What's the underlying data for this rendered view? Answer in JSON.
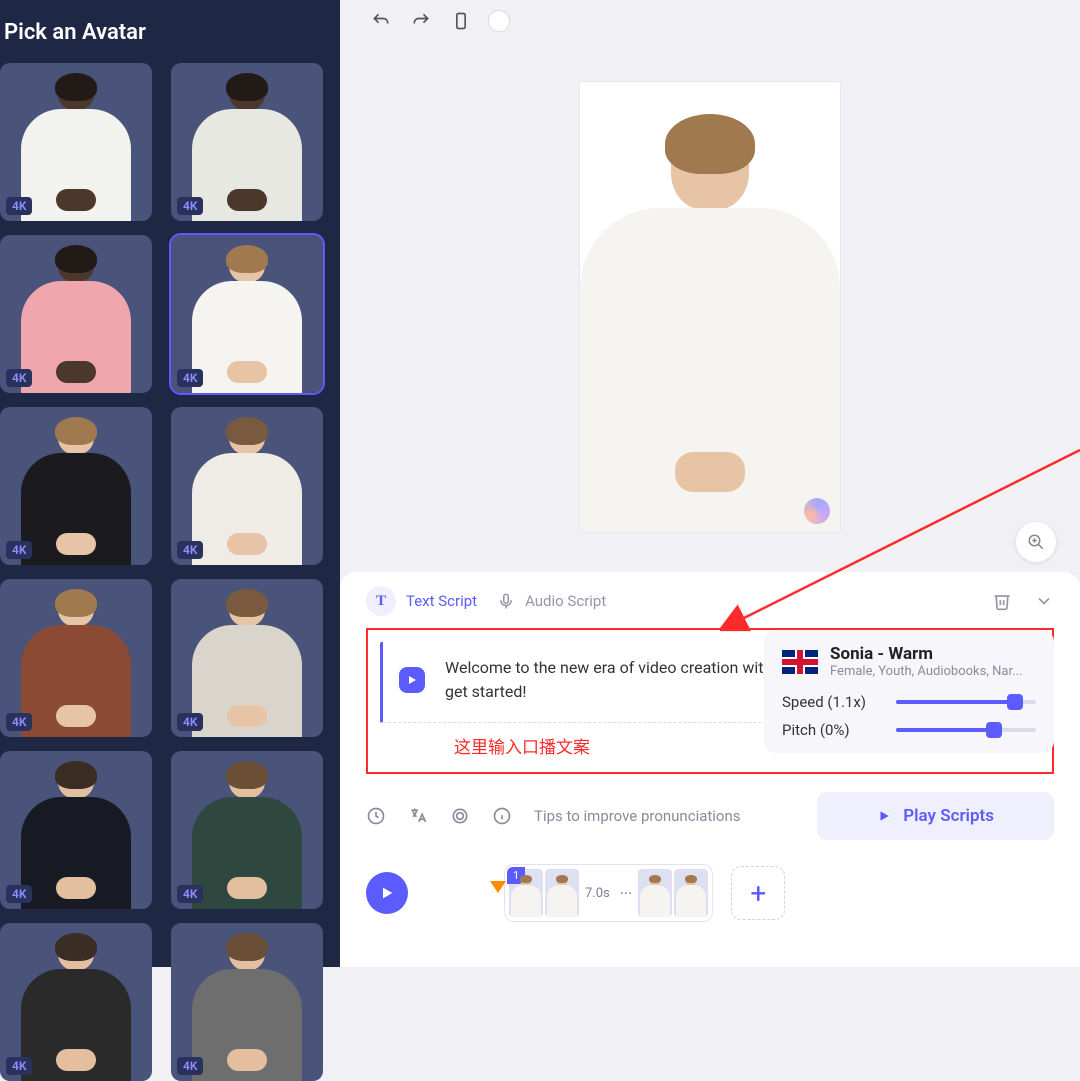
{
  "sidebar": {
    "title": "Pick an Avatar",
    "badge": "4K",
    "avatars": [
      {
        "hair": "#221a16",
        "skin": "#4b382a",
        "shirt": "#f2f2ee"
      },
      {
        "hair": "#221a16",
        "skin": "#4b382a",
        "shirt": "#e8e8e3"
      },
      {
        "hair": "#221a16",
        "skin": "#4b382a",
        "shirt": "#f0a6ad"
      },
      {
        "hair": "#a07a4e",
        "skin": "#e7c4a6",
        "shirt": "#f5f4f0",
        "selected": true
      },
      {
        "hair": "#a07a4e",
        "skin": "#e7c4a6",
        "shirt": "#1b1b1f"
      },
      {
        "hair": "#7a5a3e",
        "skin": "#e7c4a6",
        "shirt": "#efece6"
      },
      {
        "hair": "#a07a4e",
        "skin": "#e7c4a6",
        "shirt": "#8a4a33"
      },
      {
        "hair": "#7a5a3e",
        "skin": "#e7c4a6",
        "shirt": "#d9d4cc"
      },
      {
        "hair": "#3a2d24",
        "skin": "#e3bfa0",
        "shirt": "#171a22"
      },
      {
        "hair": "#6b4e36",
        "skin": "#e3bfa0",
        "shirt": "#2e473f"
      },
      {
        "hair": "#3a2d24",
        "skin": "#e3bfa0",
        "shirt": "#2a2a2a"
      },
      {
        "hair": "#6b4e36",
        "skin": "#e3bfa0",
        "shirt": "#6e6e6e"
      }
    ]
  },
  "tabs": {
    "text_script": "Text Script",
    "audio_script": "Audio Script"
  },
  "script": {
    "text": "Welcome to the new era of video creation with HeyGen! Simply type your script to get started!",
    "annotation_cn": "这里输入口播文案"
  },
  "voice": {
    "name": "Sonia - Warm",
    "tags": "Female, Youth, Audiobooks, Nar...",
    "speed_label": "Speed (1.1x)",
    "speed_pct": 85,
    "pitch_label": "Pitch (0%)",
    "pitch_pct": 70
  },
  "under": {
    "tips": "Tips to improve pronunciations",
    "play_scripts": "Play Scripts"
  },
  "timeline": {
    "index": "1",
    "duration": "7.0s"
  }
}
